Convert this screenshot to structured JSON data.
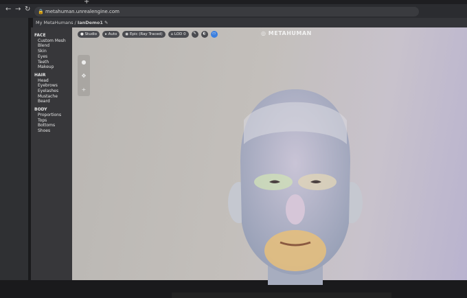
{
  "browser": {
    "url": "metahuman.unrealengine.com",
    "back": "←",
    "forward": "→",
    "reload": "↻",
    "new_tab": "+"
  },
  "breadcrumb": {
    "root": "My MetaHumans",
    "separator": "/",
    "current": "IanDemo1"
  },
  "logo": "METAHUMAN",
  "sidebar": {
    "sections": [
      {
        "title": "FACE",
        "items": [
          "Custom Mesh",
          "Blend",
          "Skin",
          "Eyes",
          "Teeth",
          "Makeup"
        ]
      },
      {
        "title": "HAIR",
        "items": [
          "Head",
          "Eyebrows",
          "Eyelashes",
          "Mustache",
          "Beard"
        ]
      },
      {
        "title": "BODY",
        "items": [
          "Proportions",
          "Tops",
          "Bottoms",
          "Shoes"
        ]
      }
    ]
  },
  "toolbar": {
    "studio": "Studio",
    "auto": "Auto",
    "quality": "Epic (Ray Traced)",
    "lod": "LOD 0"
  },
  "colors": {
    "accent": "#3a7fe0",
    "sidebar": "#37373a"
  }
}
